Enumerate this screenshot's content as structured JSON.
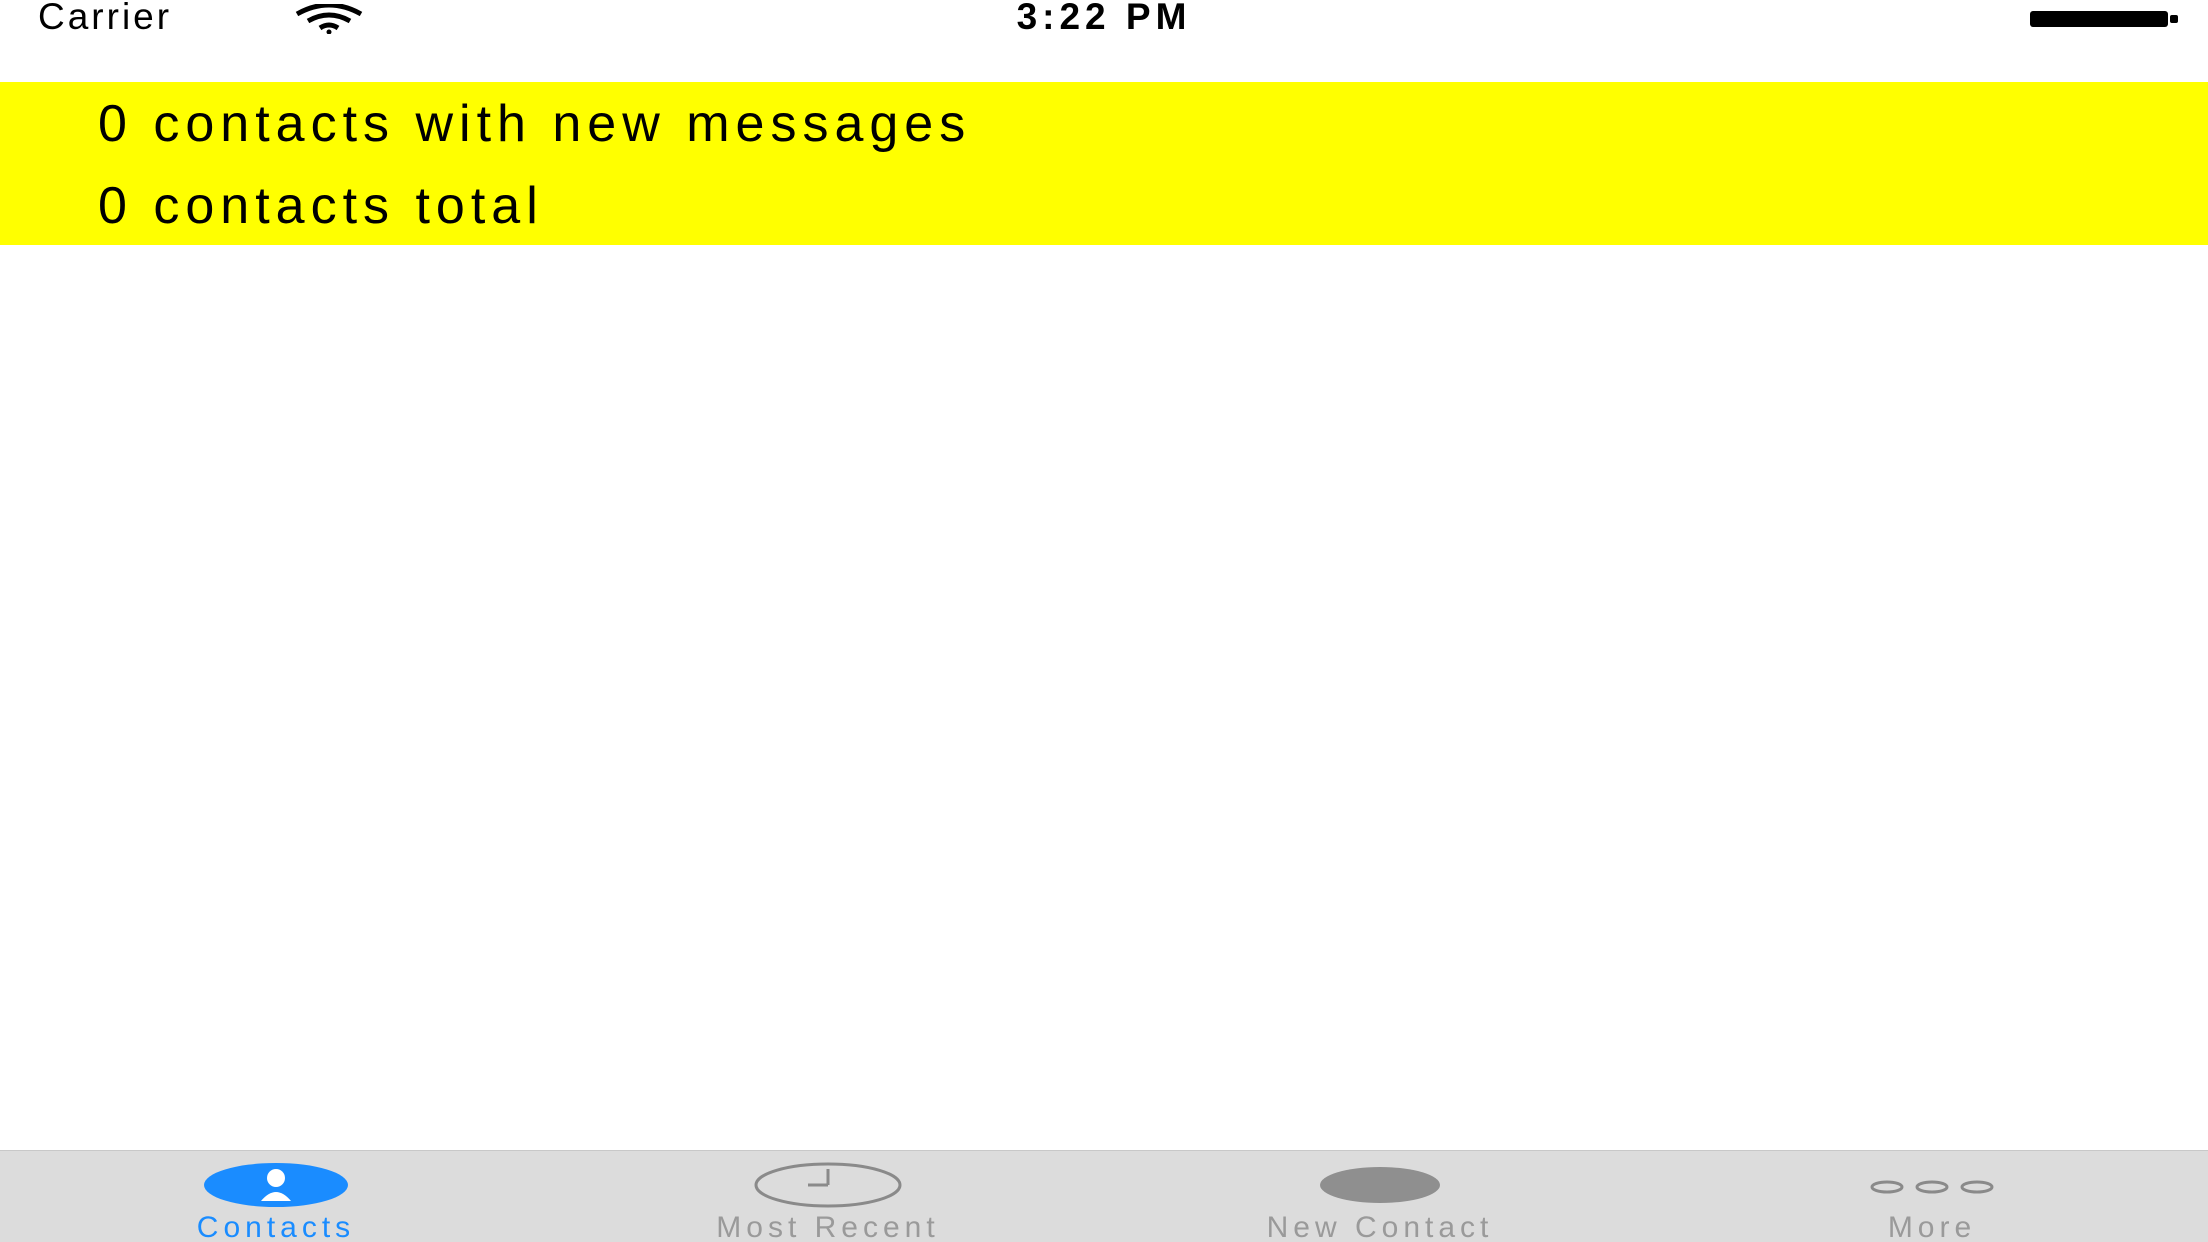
{
  "status_bar": {
    "carrier": "Carrier",
    "time": "3:22 PM"
  },
  "banner": {
    "line1": "0 contacts with new messages",
    "line2": "0 contacts total",
    "background_color": "#ffff00"
  },
  "tab_bar": {
    "active_color": "#1a8cff",
    "inactive_color": "#9a9a9a",
    "tabs": [
      {
        "label": "Contacts",
        "icon": "contacts-icon",
        "active": true
      },
      {
        "label": "Most Recent",
        "icon": "clock-icon",
        "active": false
      },
      {
        "label": "New Contact",
        "icon": "new-contact-icon",
        "active": false
      },
      {
        "label": "More",
        "icon": "more-icon",
        "active": false
      }
    ]
  }
}
